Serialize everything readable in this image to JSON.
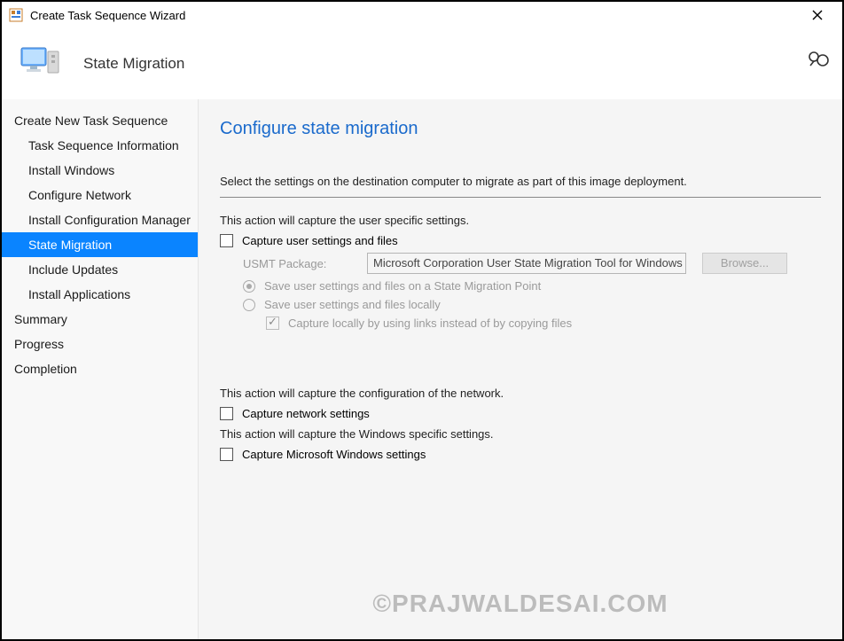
{
  "window": {
    "title": "Create Task Sequence Wizard"
  },
  "header": {
    "page_title": "State Migration"
  },
  "sidebar": {
    "items": [
      {
        "label": "Create New Task Sequence",
        "sub": false,
        "selected": false
      },
      {
        "label": "Task Sequence Information",
        "sub": true,
        "selected": false
      },
      {
        "label": "Install Windows",
        "sub": true,
        "selected": false
      },
      {
        "label": "Configure Network",
        "sub": true,
        "selected": false
      },
      {
        "label": "Install Configuration Manager",
        "sub": true,
        "selected": false
      },
      {
        "label": "State Migration",
        "sub": true,
        "selected": true
      },
      {
        "label": "Include Updates",
        "sub": true,
        "selected": false
      },
      {
        "label": "Install Applications",
        "sub": true,
        "selected": false
      },
      {
        "label": "Summary",
        "sub": false,
        "selected": false
      },
      {
        "label": "Progress",
        "sub": false,
        "selected": false
      },
      {
        "label": "Completion",
        "sub": false,
        "selected": false
      }
    ]
  },
  "main": {
    "heading": "Configure state migration",
    "intro": "Select the settings on the destination computer to migrate as part of this image deployment.",
    "section1_text": "This action will capture the user specific settings.",
    "capture_user_label": "Capture user settings and files",
    "usmt_label": "USMT Package:",
    "usmt_value": "Microsoft Corporation User State Migration Tool for Windows",
    "browse_label": "Browse...",
    "radio1_label": "Save user settings and files on a State Migration Point",
    "radio2_label": "Save user settings and files locally",
    "sub_check_label": "Capture locally by using links instead of by copying files",
    "section2_text": "This action will capture the configuration of the network.",
    "capture_network_label": "Capture network settings",
    "section3_text": "This action will capture the Windows specific settings.",
    "capture_windows_label": "Capture Microsoft Windows settings"
  },
  "watermark": "©PRAJWALDESAI.COM"
}
